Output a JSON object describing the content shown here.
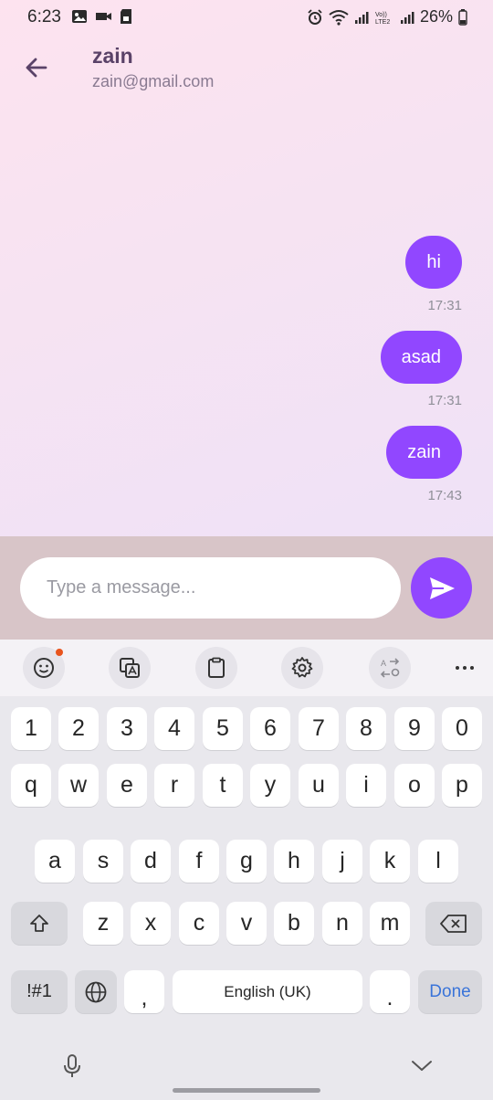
{
  "status_bar": {
    "time": "6:23",
    "battery": "26%"
  },
  "header": {
    "title": "zain",
    "subtitle": "zain@gmail.com"
  },
  "messages": [
    {
      "text": "hi",
      "time": "17:31"
    },
    {
      "text": "asad",
      "time": "17:31"
    },
    {
      "text": "zain",
      "time": "17:43"
    }
  ],
  "composer": {
    "placeholder": "Type a message..."
  },
  "keyboard": {
    "toolbar_icons": [
      "emoji-icon",
      "translate-icon",
      "clipboard-icon",
      "settings-icon",
      "text-convert-icon",
      "more-icon"
    ],
    "row_numbers": [
      "1",
      "2",
      "3",
      "4",
      "5",
      "6",
      "7",
      "8",
      "9",
      "0"
    ],
    "row_1": [
      "q",
      "w",
      "e",
      "r",
      "t",
      "y",
      "u",
      "i",
      "o",
      "p"
    ],
    "row_2": [
      "a",
      "s",
      "d",
      "f",
      "g",
      "h",
      "j",
      "k",
      "l"
    ],
    "row_3": [
      "z",
      "x",
      "c",
      "v",
      "b",
      "n",
      "m"
    ],
    "symbols_key": "!#1",
    "comma_key": ",",
    "space_label": "English (UK)",
    "period_key": ".",
    "done_label": "Done"
  },
  "colors": {
    "accent": "#9147ff",
    "composer_bg": "#d8c5c8",
    "header_text": "#5a4268"
  }
}
